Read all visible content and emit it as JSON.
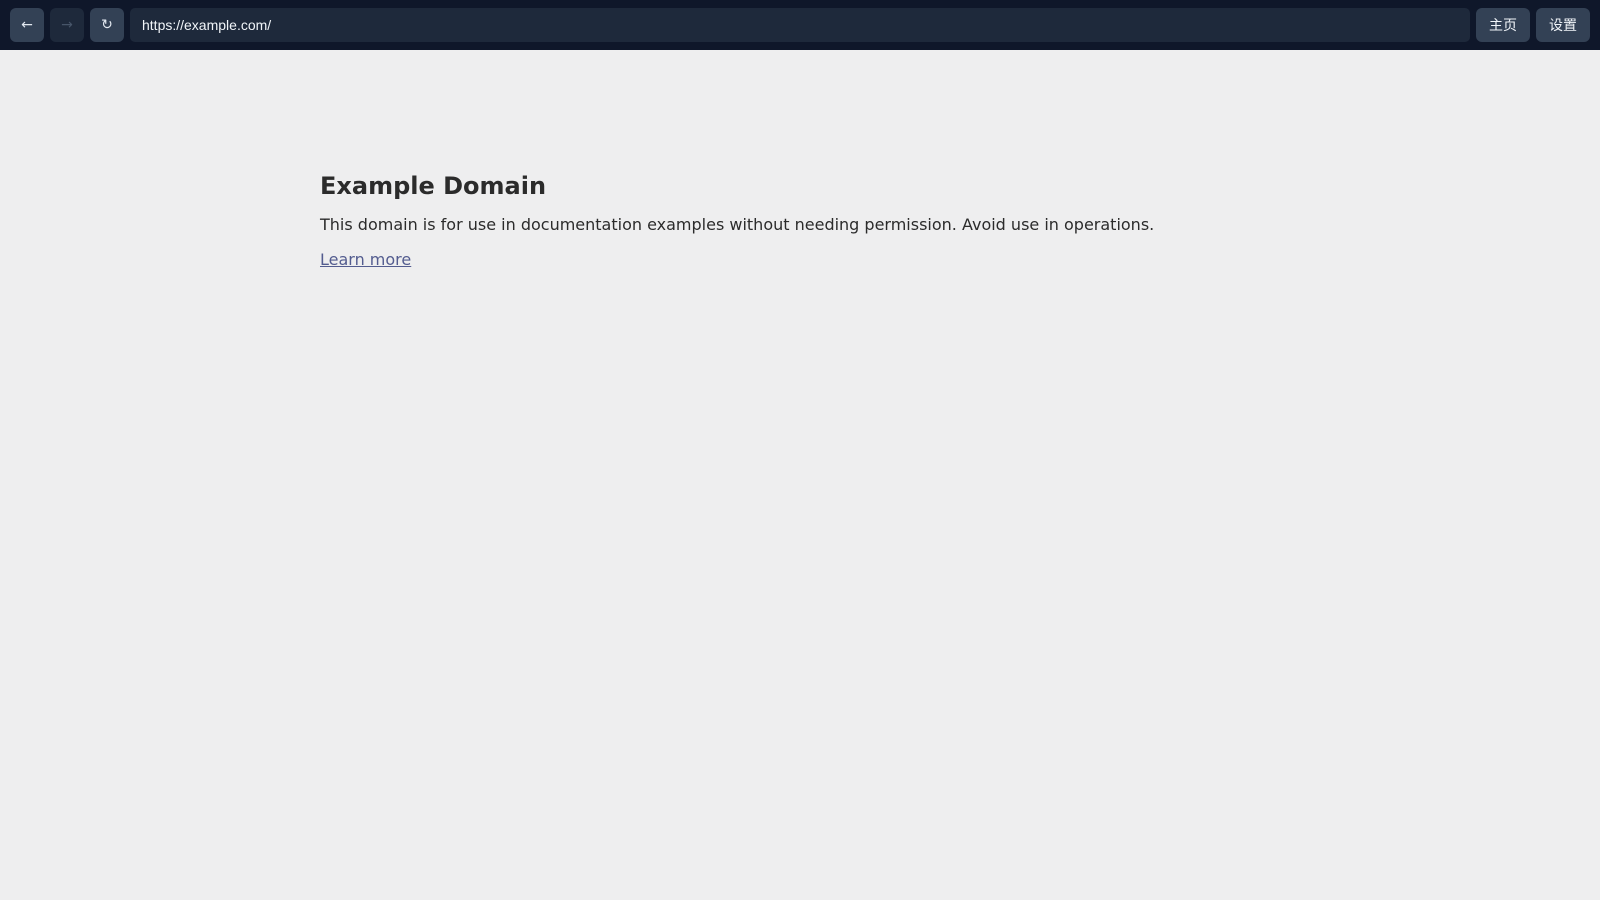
{
  "toolbar": {
    "back_icon": "←",
    "forward_icon": "→",
    "reload_icon": "↻",
    "url": "https://example.com/",
    "home_label": "主页",
    "settings_label": "设置"
  },
  "page": {
    "title": "Example Domain",
    "description": "This domain is for use in documentation examples without needing permission. Avoid use in operations.",
    "link_text": "Learn more"
  },
  "colors": {
    "toolbar_bg": "#0f172a",
    "page_bg": "#eeeeef",
    "text": "#2b2b2b",
    "link": "#535c8f"
  }
}
